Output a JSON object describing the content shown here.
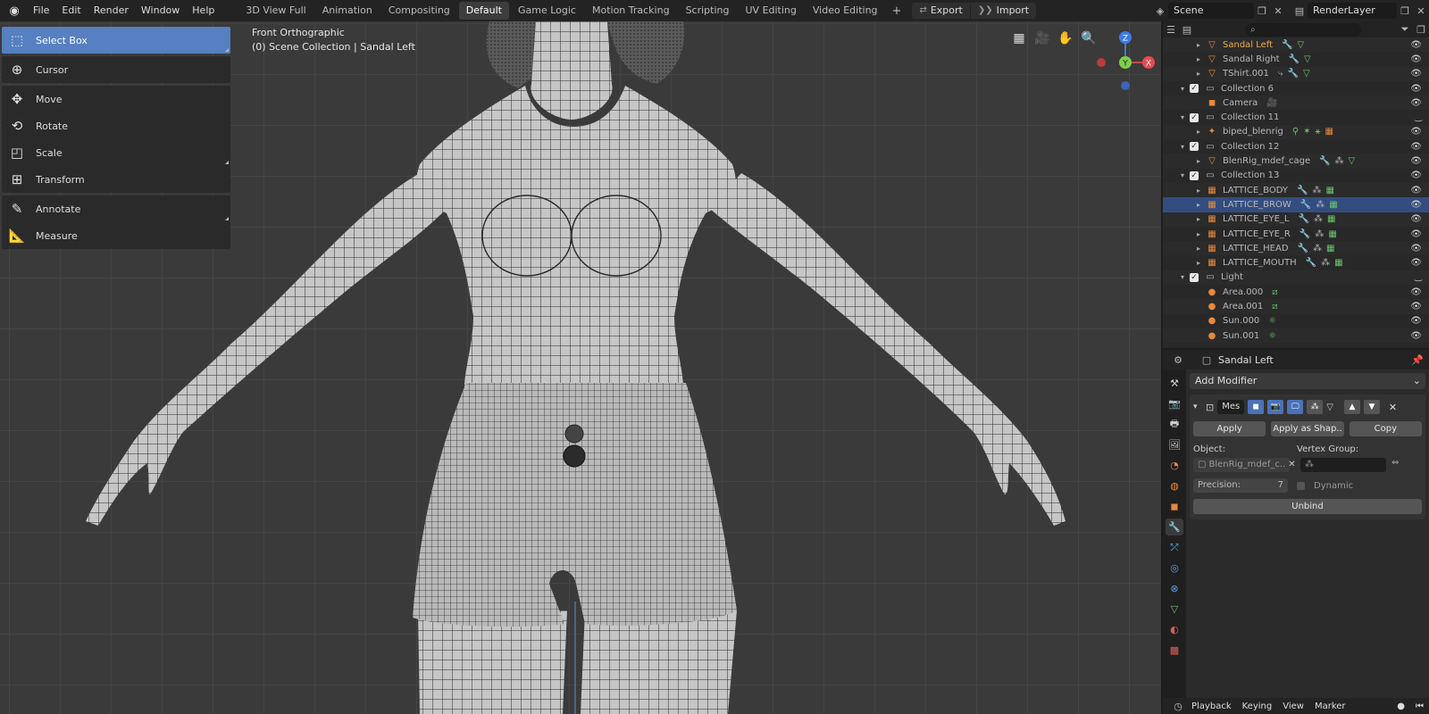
{
  "menu": [
    "File",
    "Edit",
    "Render",
    "Window",
    "Help"
  ],
  "workspaces": [
    "3D View Full",
    "Animation",
    "Compositing",
    "Default",
    "Game Logic",
    "Motion Tracking",
    "Scripting",
    "UV Editing",
    "Video Editing"
  ],
  "active_workspace": "Default",
  "io": {
    "export_label": "Export",
    "import_label": "Import"
  },
  "scene": {
    "scene_name": "Scene",
    "render_layer": "RenderLayer"
  },
  "viewport": {
    "view_name": "Front Orthographic",
    "collection_info": "(0) Scene Collection | Sandal Left",
    "axes": {
      "z": "Z",
      "y": "Y",
      "x": "X"
    }
  },
  "tools": [
    {
      "label": "Select Box",
      "icon": "select-box-icon",
      "active": true
    },
    {
      "label": "Cursor",
      "icon": "cursor-icon"
    },
    {
      "label": "Move",
      "icon": "move-icon"
    },
    {
      "label": "Rotate",
      "icon": "rotate-icon"
    },
    {
      "label": "Scale",
      "icon": "scale-icon"
    },
    {
      "label": "Transform",
      "icon": "transform-icon"
    },
    {
      "label": "Annotate",
      "icon": "annotate-icon"
    },
    {
      "label": "Measure",
      "icon": "measure-icon"
    }
  ],
  "outliner": {
    "rows": [
      {
        "label": "Sandal Left",
        "type": "mesh",
        "active_label": true
      },
      {
        "label": "Sandal Right",
        "type": "mesh"
      },
      {
        "label": "TShirt.001",
        "type": "mesh"
      },
      {
        "label": "Collection 6",
        "type": "collection"
      },
      {
        "label": "Camera",
        "type": "camera"
      },
      {
        "label": "Collection 11",
        "type": "collection"
      },
      {
        "label": "biped_blenrig",
        "type": "armature"
      },
      {
        "label": "Collection 12",
        "type": "collection"
      },
      {
        "label": "BlenRig_mdef_cage",
        "type": "mesh"
      },
      {
        "label": "Collection 13",
        "type": "collection"
      },
      {
        "label": "LATTICE_BODY",
        "type": "lattice"
      },
      {
        "label": "LATTICE_BROW",
        "type": "lattice",
        "selected": true
      },
      {
        "label": "LATTICE_EYE_L",
        "type": "lattice"
      },
      {
        "label": "LATTICE_EYE_R",
        "type": "lattice"
      },
      {
        "label": "LATTICE_HEAD",
        "type": "lattice"
      },
      {
        "label": "LATTICE_MOUTH",
        "type": "lattice"
      },
      {
        "label": "Light",
        "type": "collection"
      },
      {
        "label": "Area.000",
        "type": "light"
      },
      {
        "label": "Area.001",
        "type": "light"
      },
      {
        "label": "Sun.000",
        "type": "light"
      },
      {
        "label": "Sun.001",
        "type": "light"
      }
    ]
  },
  "properties": {
    "object_name": "Sandal Left",
    "add_modifier": "Add Modifier",
    "modifier_name": "Mes",
    "apply": "Apply",
    "apply_shape": "Apply as Shap..",
    "copy": "Copy",
    "object_label": "Object:",
    "object_value": "BlenRig_mdef_c..",
    "vertex_group_label": "Vertex Group:",
    "precision_label": "Precision:",
    "precision_value": "7",
    "dynamic_label": "Dynamic",
    "unbind": "Unbind"
  },
  "timeline": {
    "playback": "Playback",
    "keying": "Keying",
    "view": "View",
    "marker": "Marker"
  }
}
